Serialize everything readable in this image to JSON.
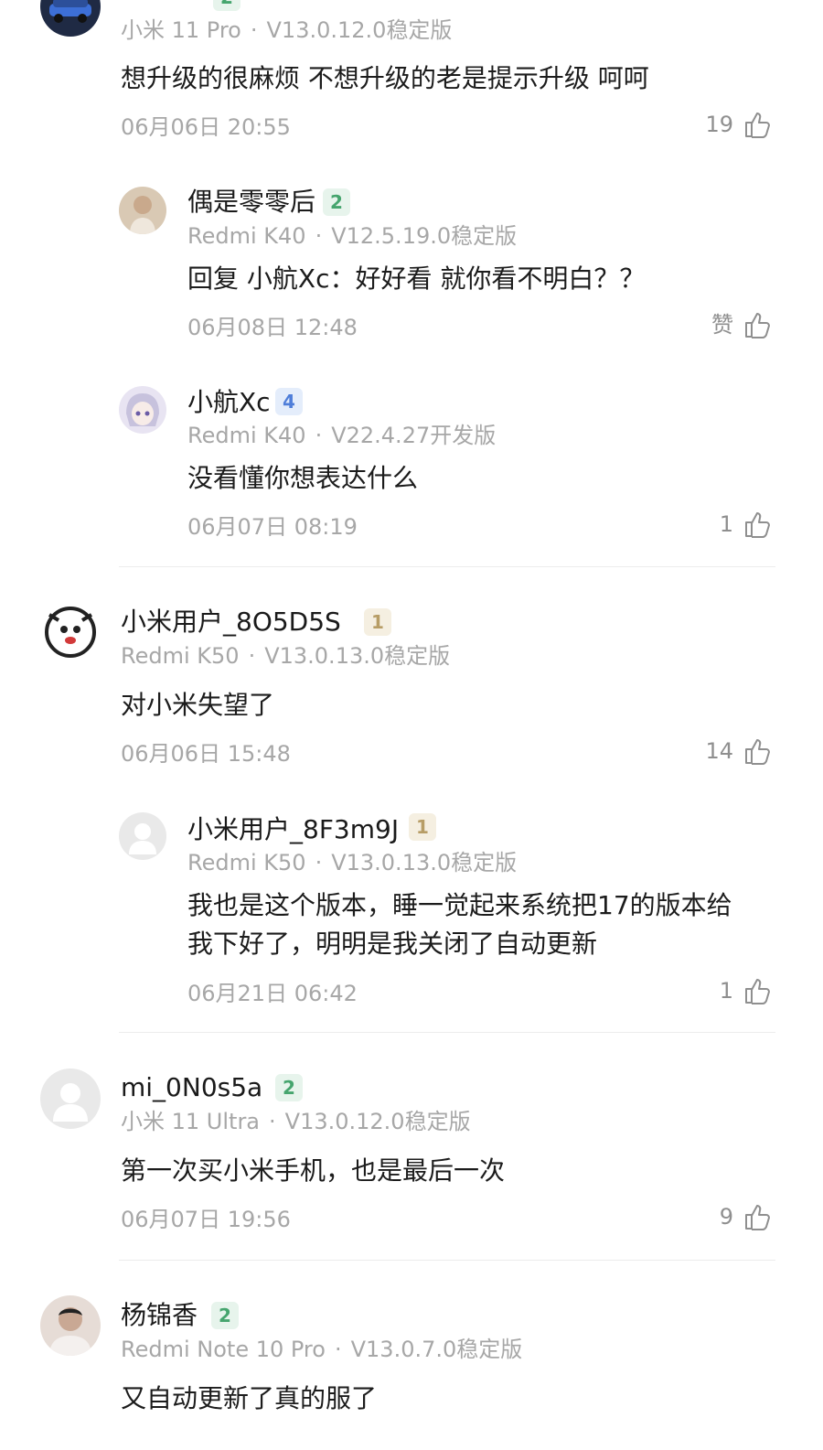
{
  "comments": [
    {
      "id": "c1",
      "name": "",
      "device": "小米 11 Pro",
      "version": "V13.0.12.0稳定版",
      "text": "想升级的很麻烦 不想升级的老是提示升级 呵呵",
      "time": "06月06日 20:55",
      "likes": "19",
      "avatar_icon": "car-avatar"
    },
    {
      "id": "r1",
      "name": "偶是零零后",
      "level": "2",
      "device": "Redmi K40",
      "version": "V12.5.19.0稳定版",
      "text": "回复 小航Xc：好好看 就你看不明白？？",
      "time": "06月08日 12:48",
      "likes": "赞",
      "avatar_icon": "photo-avatar"
    },
    {
      "id": "r2",
      "name": "小航Xc",
      "level": "4",
      "device": "Redmi K40",
      "version": "V22.4.27开发版",
      "text": "没看懂你想表达什么",
      "time": "06月07日 08:19",
      "likes": "1",
      "avatar_icon": "anime-avatar"
    },
    {
      "id": "c2",
      "name": "小米用户_8O5D5S",
      "level": "1",
      "device": "Redmi K50",
      "version": "V13.0.13.0稳定版",
      "text": "对小米失望了",
      "time": "06月06日 15:48",
      "likes": "14",
      "avatar_icon": "cartoon-avatar"
    },
    {
      "id": "r3",
      "name": "小米用户_8F3m9J",
      "level": "1",
      "device": "Redmi K50",
      "version": "V13.0.13.0稳定版",
      "text_line1": "我也是这个版本，睡一觉起来系统把17的版本给",
      "text_line2": "我下好了，明明是我关闭了自动更新",
      "time": "06月21日 06:42",
      "likes": "1",
      "avatar_icon": "default-avatar"
    },
    {
      "id": "c3",
      "name": "mi_0N0s5a",
      "level": "2",
      "device": "小米 11 Ultra",
      "version": "V13.0.12.0稳定版",
      "text": "第一次买小米手机，也是最后一次",
      "time": "06月07日 19:56",
      "likes": "9",
      "avatar_icon": "default-avatar"
    },
    {
      "id": "c4",
      "name": "杨锦香",
      "level": "2",
      "device": "Redmi Note 10 Pro",
      "version": "V13.0.7.0稳定版",
      "text": "又自动更新了真的服了",
      "avatar_icon": "photo-avatar"
    }
  ],
  "separator": "·",
  "colors": {
    "muted_text": "#a7a7a7",
    "level1": "#b79d66",
    "level2": "#46a56e",
    "level4": "#4f7ed9"
  }
}
